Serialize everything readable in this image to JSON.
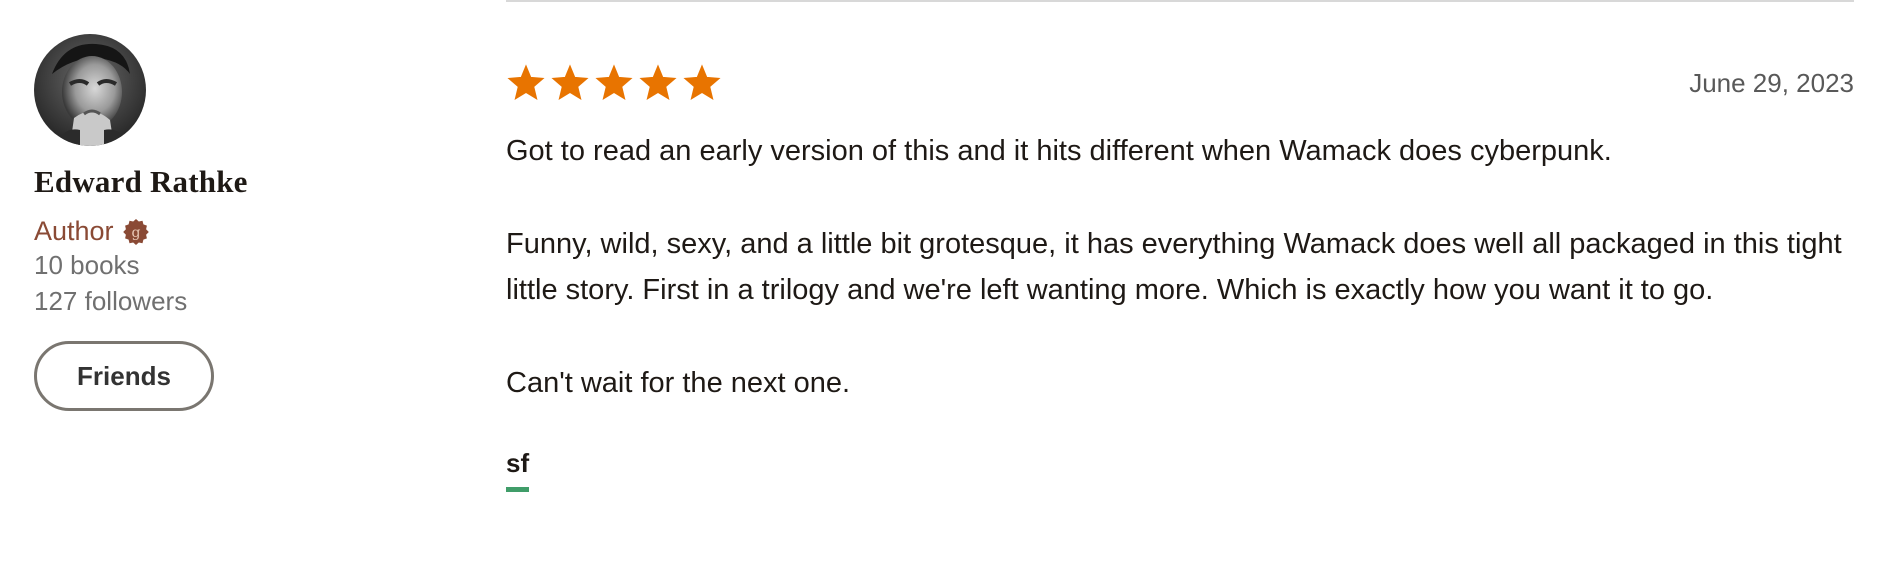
{
  "reviewer": {
    "avatar_alt": "Edward Rathke",
    "name": "Edward Rathke",
    "role_label": "Author",
    "badge_icon": "goodreads-author-badge-icon",
    "books": "10 books",
    "followers": "127 followers",
    "friends_button": "Friends"
  },
  "review": {
    "rating": 5,
    "rating_max": 5,
    "star_color": "#e87400",
    "date": "June 29, 2023",
    "paragraphs": [
      "Got to read an early version of this and it hits different when Wamack does cyberpunk.",
      "Funny, wild, sexy, and a little bit grotesque, it has everything Wamack does well all packaged in this tight little story. First in a trilogy and we're left wanting more. Which is exactly how you want it to go.",
      "Can't wait for the next one."
    ],
    "shelf": "sf"
  },
  "colors": {
    "author_accent": "#8a4a35",
    "shelf_underline": "#409d69",
    "muted_text": "#707070"
  }
}
